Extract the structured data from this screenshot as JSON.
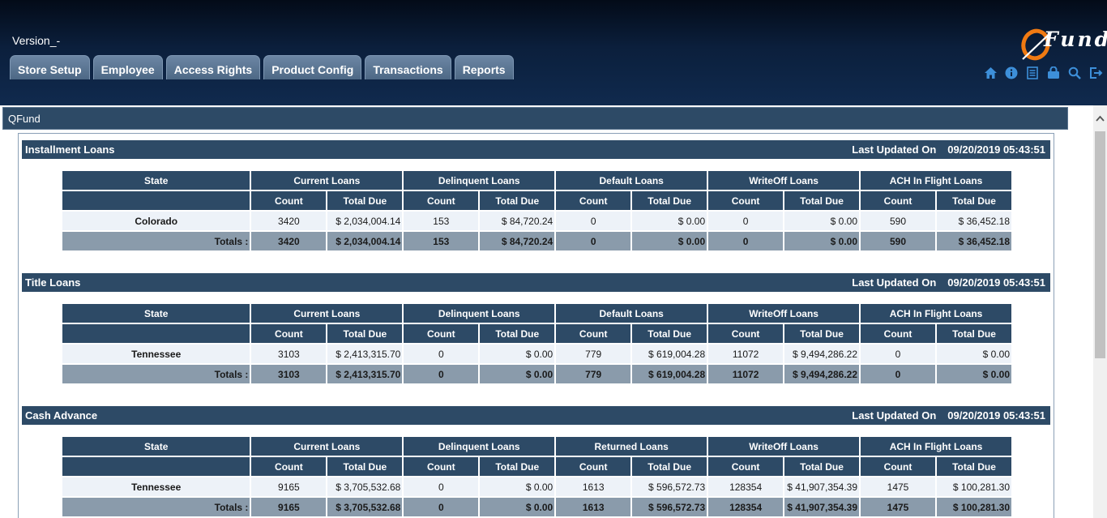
{
  "header": {
    "version": "Version_-",
    "logo_text": "Fund",
    "tabs": [
      "Store Setup",
      "Employee",
      "Access Rights",
      "Product Config",
      "Transactions",
      "Reports"
    ],
    "icons": [
      "home-icon",
      "info-icon",
      "document-icon",
      "lock-icon",
      "search-icon",
      "logout-icon"
    ]
  },
  "panel": {
    "title": "QFund"
  },
  "labels": {
    "last_updated": "Last Updated On",
    "state": "State",
    "count": "Count",
    "total_due": "Total Due",
    "totals": "Totals :"
  },
  "sections": [
    {
      "title": "Installment Loans",
      "updated": "09/20/2019 05:43:51",
      "groups": [
        "Current Loans",
        "Delinquent Loans",
        "Default Loans",
        "WriteOff Loans",
        "ACH In Flight Loans"
      ],
      "row": {
        "state": "Colorado",
        "values": [
          "3420",
          "$ 2,034,004.14",
          "153",
          "$ 84,720.24",
          "0",
          "$ 0.00",
          "0",
          "$ 0.00",
          "590",
          "$ 36,452.18"
        ]
      },
      "totals": [
        "3420",
        "$ 2,034,004.14",
        "153",
        "$ 84,720.24",
        "0",
        "$ 0.00",
        "0",
        "$ 0.00",
        "590",
        "$ 36,452.18"
      ]
    },
    {
      "title": "Title Loans",
      "updated": "09/20/2019 05:43:51",
      "groups": [
        "Current Loans",
        "Delinquent Loans",
        "Default Loans",
        "WriteOff Loans",
        "ACH In Flight Loans"
      ],
      "row": {
        "state": "Tennessee",
        "values": [
          "3103",
          "$ 2,413,315.70",
          "0",
          "$ 0.00",
          "779",
          "$ 619,004.28",
          "11072",
          "$ 9,494,286.22",
          "0",
          "$ 0.00"
        ]
      },
      "totals": [
        "3103",
        "$ 2,413,315.70",
        "0",
        "$ 0.00",
        "779",
        "$ 619,004.28",
        "11072",
        "$ 9,494,286.22",
        "0",
        "$ 0.00"
      ]
    },
    {
      "title": "Cash Advance",
      "updated": "09/20/2019 05:43:51",
      "groups": [
        "Current Loans",
        "Delinquent Loans",
        "Returned Loans",
        "WriteOff Loans",
        "ACH In Flight Loans"
      ],
      "row": {
        "state": "Tennessee",
        "values": [
          "9165",
          "$ 3,705,532.68",
          "0",
          "$ 0.00",
          "1613",
          "$ 596,572.73",
          "128354",
          "$ 41,907,354.39",
          "1475",
          "$ 100,281.30"
        ]
      },
      "totals": [
        "9165",
        "$ 3,705,532.68",
        "0",
        "$ 0.00",
        "1613",
        "$ 596,572.73",
        "128354",
        "$ 41,907,354.39",
        "1475",
        "$ 100,281.30"
      ]
    }
  ],
  "colors": {
    "header_bg": "#0b1f3c",
    "section_bg": "#2d4a66",
    "row_bg": "#edf2f8",
    "totals_bg": "#8a9bab",
    "logo_accent": "#f07a12"
  }
}
